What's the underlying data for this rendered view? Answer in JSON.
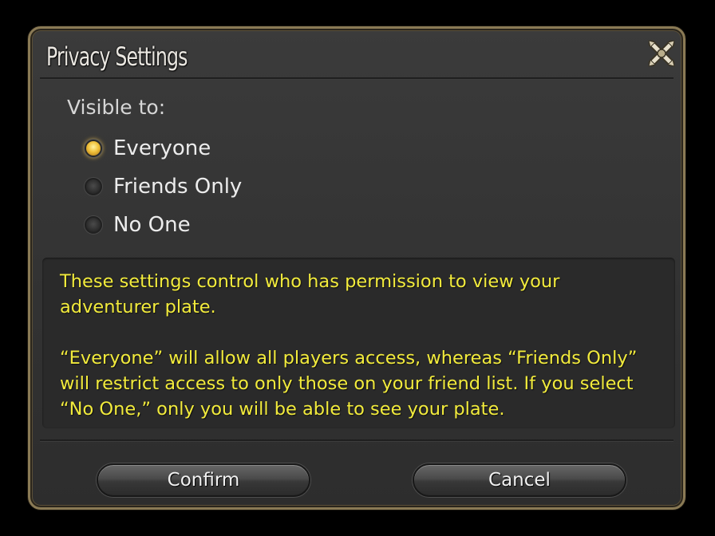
{
  "dialog": {
    "title": "Privacy Settings",
    "close_icon": "close-cross-icon"
  },
  "visibility": {
    "label": "Visible to:",
    "options": [
      {
        "label": "Everyone",
        "selected": true
      },
      {
        "label": "Friends Only",
        "selected": false
      },
      {
        "label": "No One",
        "selected": false
      }
    ]
  },
  "info": {
    "paragraph1": "These settings control who has permission to view your adventurer plate.",
    "paragraph2": "“Everyone” will allow all players access, whereas “Friends Only” will restrict access to only those on your friend list. If you select “No One,” only you will be able to see your plate."
  },
  "buttons": {
    "confirm_label": "Confirm",
    "cancel_label": "Cancel"
  },
  "colors": {
    "info_text": "#f2eb3c",
    "selected_radio": "#f1c23b",
    "frame_gold": "#8a7a55"
  }
}
